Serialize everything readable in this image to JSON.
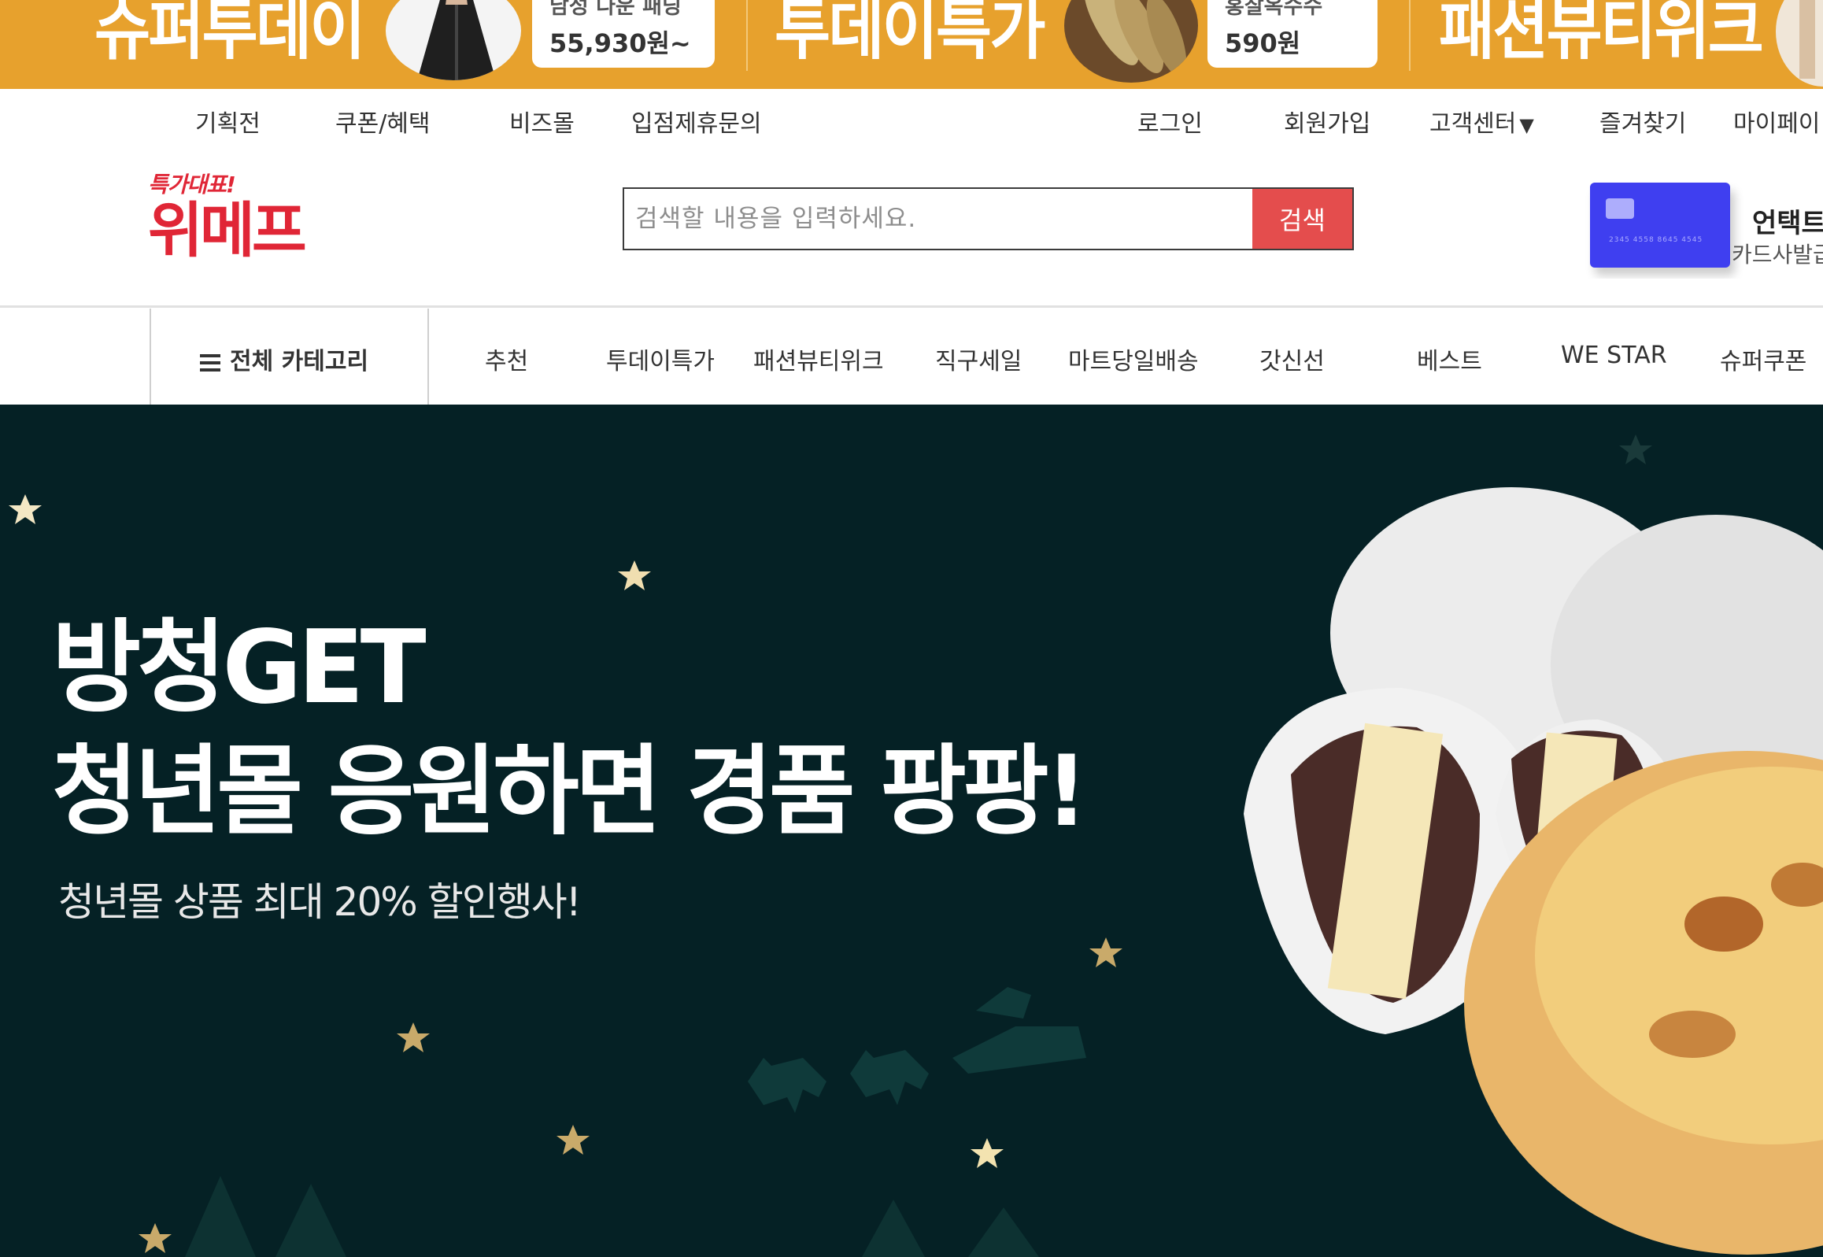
{
  "promo_banner": {
    "items": [
      {
        "title": "슈퍼투데이",
        "subtitle": "남성 다운 패딩",
        "price": "55,930원~"
      },
      {
        "title": "투데이특가",
        "subtitle": "홍찰옥수수",
        "price": "590원"
      },
      {
        "title": "패션뷰티위크"
      }
    ]
  },
  "utility_nav": {
    "left": [
      "기획전",
      "쿠폰/혜택",
      "비즈몰",
      "입점제휴문의"
    ],
    "right": [
      "로그인",
      "회원가입",
      "고객센터",
      "즐겨찾기",
      "마이페이"
    ],
    "caret": "▼"
  },
  "header": {
    "logo_tag": "특가대표!",
    "logo_brand": "위메프",
    "search": {
      "placeholder": "검색할 내용을 입력하세요.",
      "value": "",
      "button": "검색"
    },
    "ad": {
      "title": "언택트",
      "subtitle": "카드사발급",
      "card_number": "2345 4558 8645 4545"
    }
  },
  "category_nav": {
    "all_label": "전체 카테고리",
    "items": [
      "추천",
      "투데이특가",
      "패션뷰티위크",
      "직구세일",
      "마트당일배송",
      "갓신선",
      "베스트",
      "WE STAR",
      "슈퍼쿠폰"
    ]
  },
  "hero": {
    "line1": "방청GET",
    "line2": "청년몰 응원하면 경품 팡팡!",
    "subline": "청년몰 상품 최대 20% 할인행사!",
    "colors": {
      "background": "#052125",
      "star": "#e9d3a0",
      "text": "#ffffff"
    }
  },
  "colors": {
    "brand": "#e02636",
    "search_button": "#e44d4d",
    "promo": "#e7a12d"
  }
}
